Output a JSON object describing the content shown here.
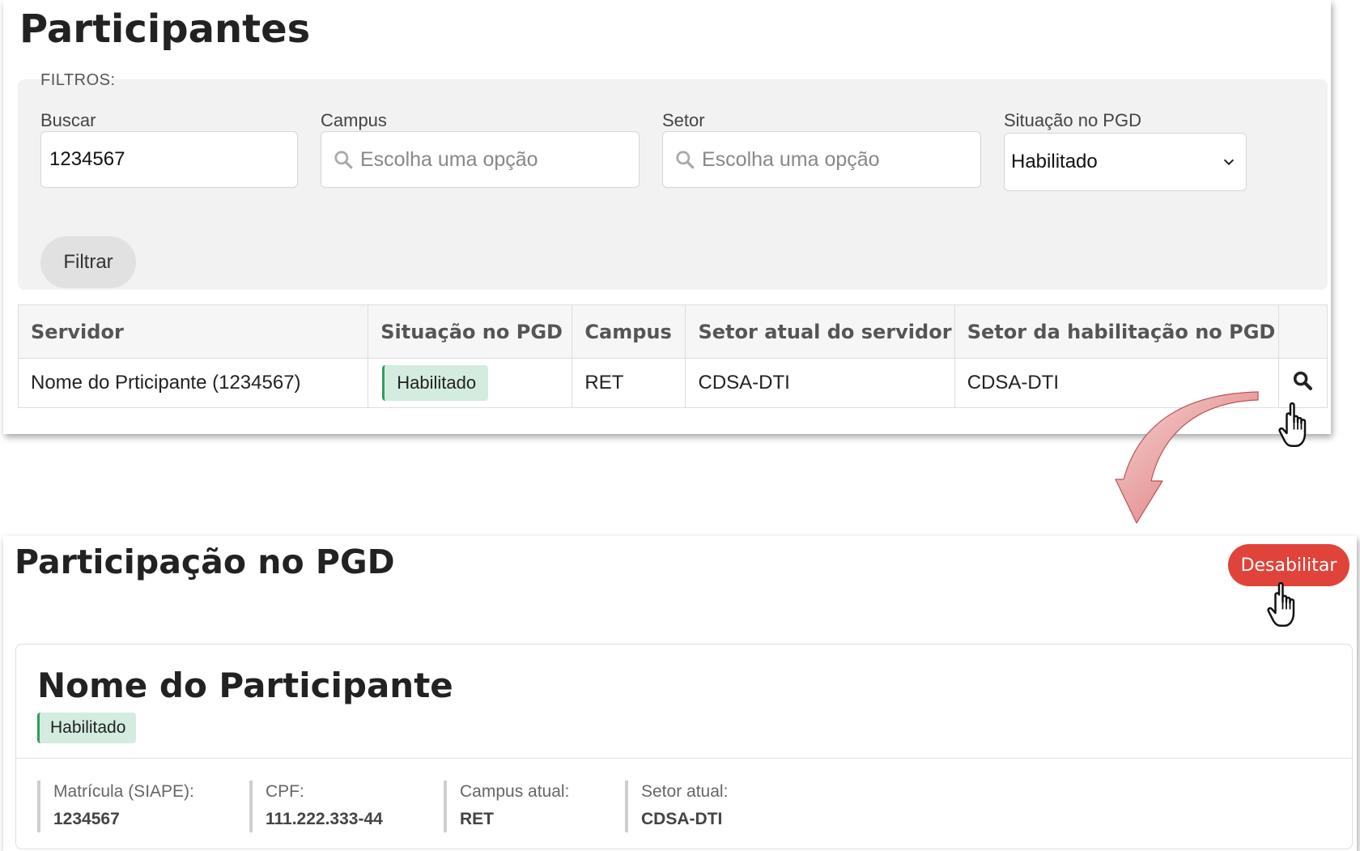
{
  "participants": {
    "title": "Participantes",
    "filters": {
      "legend": "FILTROS:",
      "search": {
        "label": "Buscar",
        "value": "1234567"
      },
      "campus": {
        "label": "Campus",
        "placeholder": "Escolha uma opção"
      },
      "sector": {
        "label": "Setor",
        "placeholder": "Escolha uma opção"
      },
      "status": {
        "label": "Situação no PGD",
        "value": "Habilitado"
      },
      "filter_button": "Filtrar"
    },
    "table": {
      "headers": [
        "Servidor",
        "Situação no PGD",
        "Campus",
        "Setor atual do servidor",
        "Setor da habilitação no PGD",
        ""
      ],
      "rows": [
        {
          "servidor": "Nome do Prticipante (1234567)",
          "situacao": "Habilitado",
          "campus": "RET",
          "setor_atual": "CDSA-DTI",
          "setor_habilitacao": "CDSA-DTI"
        }
      ]
    }
  },
  "participation": {
    "title": "Participação no PGD",
    "disable_button": "Desabilitar",
    "card": {
      "name": "Nome do Participante",
      "status": "Habilitado",
      "fields": [
        {
          "label": "Matrícula (SIAPE):",
          "value": "1234567"
        },
        {
          "label": "CPF:",
          "value": "111.222.333-44"
        },
        {
          "label": "Campus atual:",
          "value": "RET"
        },
        {
          "label": "Setor atual:",
          "value": "CDSA-DTI"
        }
      ]
    }
  },
  "colors": {
    "badge_bg": "#d4ecdf",
    "badge_border": "#2e9e5b",
    "danger_button": "#e0433a",
    "arrow": "#e79a9a"
  },
  "icons": [
    "search-icon",
    "chevron-down-icon",
    "pointer-hand-icon",
    "curved-arrow"
  ]
}
